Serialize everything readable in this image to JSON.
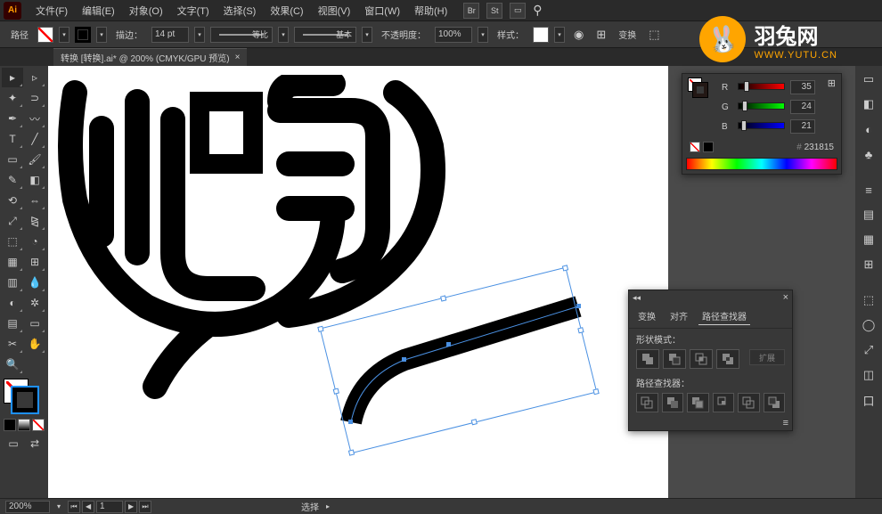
{
  "app": {
    "logo": "Ai"
  },
  "menu": {
    "items": [
      "文件(F)",
      "编辑(E)",
      "对象(O)",
      "文字(T)",
      "选择(S)",
      "效果(C)",
      "视图(V)",
      "窗口(W)",
      "帮助(H)"
    ],
    "icons": [
      "Br",
      "St"
    ]
  },
  "controlbar": {
    "tool_label": "路径",
    "stroke_label": "描边：",
    "stroke_width": "14 pt",
    "uniform": "等比",
    "profile": "基本",
    "opacity_label": "不透明度：",
    "opacity": "100%",
    "style_label": "样式：",
    "transform_label": "变换"
  },
  "document": {
    "tab_title": "转换   [转换].ai* @ 200% (CMYK/GPU 预览)"
  },
  "color": {
    "mode_icon": "⊞",
    "channels": [
      {
        "label": "R",
        "value": "35",
        "gradient": "linear-gradient(to right,#000,#f00)",
        "pos": 14
      },
      {
        "label": "G",
        "value": "24",
        "gradient": "linear-gradient(to right,#000,#0f0)",
        "pos": 10
      },
      {
        "label": "B",
        "value": "21",
        "gradient": "linear-gradient(to right,#000,#00f)",
        "pos": 8
      }
    ],
    "hex": "231815"
  },
  "pathfinder": {
    "tabs": [
      "变换",
      "对齐",
      "路径查找器"
    ],
    "active_tab": 2,
    "shape_label": "形状模式：",
    "pathfinder_label": "路径查找器：",
    "expand": "扩展"
  },
  "status": {
    "zoom": "200%",
    "page": "1",
    "tool": "选择"
  },
  "watermark": {
    "title": "羽兔网",
    "url": "WWW.YUTU.CN"
  },
  "right_dock_icons": [
    "▭",
    "◧",
    "◐",
    "♣",
    "≡",
    "▤",
    "▦",
    "⊞",
    "⬚",
    "◯",
    "⤢",
    "◫",
    "口"
  ]
}
